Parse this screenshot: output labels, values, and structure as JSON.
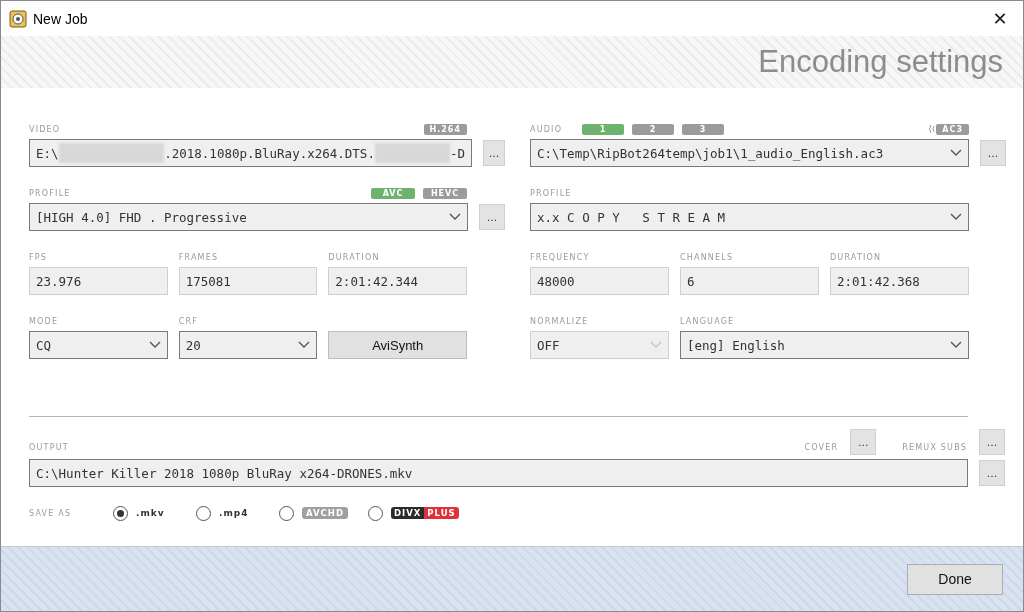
{
  "window": {
    "title": "New Job",
    "close": "✕"
  },
  "header": {
    "title": "Encoding settings"
  },
  "video": {
    "label": "VIDEO",
    "codec_badge": "H.264",
    "path_parts": [
      "E:\\",
      ".2018.1080p.BluRay.x264.DTS.",
      "-D"
    ],
    "browse": "...",
    "profile_label": "PROFILE",
    "codecs": [
      {
        "label": "AVC",
        "selected": true
      },
      {
        "label": "HEVC",
        "selected": false
      }
    ],
    "profile": "[HIGH 4.0] FHD . Progressive",
    "profile_browse": "...",
    "info": [
      {
        "label": "FPS",
        "value": "23.976"
      },
      {
        "label": "FRAMES",
        "value": "175081"
      },
      {
        "label": "DURATION",
        "value": "2:01:42.344"
      }
    ],
    "mode": {
      "label": "MODE",
      "value": "CQ",
      "disabled": false
    },
    "crf": {
      "label": "CRF",
      "value": "20",
      "disabled": false
    },
    "avisynth_button": "AviSynth"
  },
  "audio": {
    "label": "AUDIO",
    "tracks": [
      {
        "label": "1",
        "selected": true
      },
      {
        "label": "2",
        "selected": false
      },
      {
        "label": "3",
        "selected": false
      }
    ],
    "codec_badge": "AC3",
    "path": "C:\\Temp\\RipBot264temp\\job1\\1_audio_English.ac3",
    "browse": "...",
    "profile_label": "PROFILE",
    "profile": "x.x C O P Y   S T R E A M",
    "info": [
      {
        "label": "FREQUENCY",
        "value": "48000"
      },
      {
        "label": "CHANNELS",
        "value": "6"
      },
      {
        "label": "DURATION",
        "value": "2:01:42.368"
      }
    ],
    "normalize": {
      "label": "NORMALIZE",
      "value": "OFF",
      "disabled": true
    },
    "language": {
      "label": "LANGUAGE",
      "value": "[eng] English",
      "disabled": false
    }
  },
  "output": {
    "label": "OUTPUT",
    "cover_label": "COVER",
    "cover_browse": "...",
    "subs_label": "REMUX SUBS",
    "subs_browse": "...",
    "path": "C:\\Hunter Killer 2018 1080p BluRay x264-DRONES.mkv",
    "browse": "...",
    "save_as_label": "SAVE AS",
    "formats": [
      {
        "kind": "text",
        "parts": [
          ".mkv"
        ],
        "selected": true
      },
      {
        "kind": "text",
        "parts": [
          ".mp4"
        ],
        "selected": false
      },
      {
        "kind": "badge",
        "parts": [
          "AVCHD"
        ],
        "selected": false
      },
      {
        "kind": "split",
        "parts": [
          "DIVX",
          "PLUS"
        ],
        "selected": false
      }
    ]
  },
  "footer": {
    "done_button": "Done"
  }
}
